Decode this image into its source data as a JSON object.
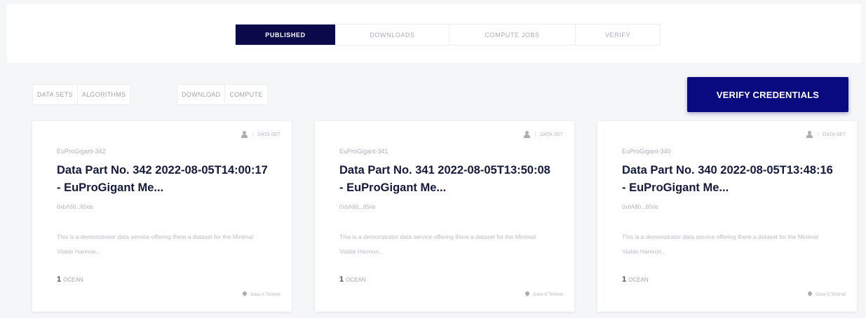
{
  "main_tabs": [
    {
      "label": "PUBLISHED",
      "active": true
    },
    {
      "label": "DOWNLOADS",
      "active": false
    },
    {
      "label": "COMPUTE JOBS",
      "active": false
    },
    {
      "label": "VERIFY",
      "active": false
    }
  ],
  "filters": {
    "asset_type": [
      "DATA SETS",
      "ALGORITHMS"
    ],
    "access_type": [
      "DOWNLOAD",
      "COMPUTE"
    ]
  },
  "verify_button": {
    "label": "VERIFY CREDENTIALS"
  },
  "cards": [
    {
      "type_label": "DATA SET",
      "symbol": "EuProGigant-342",
      "title": "Data Part No. 342 2022-08-05T14:00:17 - EuProGigant Me...",
      "author": "0xbA80...85eb",
      "description": "This is a demonstrator data service offering there a dataset for the Minimal Viable Harmon...",
      "price_value": "1",
      "price_currency": "OCEAN",
      "footer": "Gaia-X Testnet"
    },
    {
      "type_label": "DATA SET",
      "symbol": "EuProGigant-341",
      "title": "Data Part No. 341 2022-08-05T13:50:08 - EuProGigant Me...",
      "author": "0xbA80...85eb",
      "description": "This is a demonstrator data service offering there a dataset for the Minimal Viable Harmon...",
      "price_value": "1",
      "price_currency": "OCEAN",
      "footer": "Gaia-X Testnet"
    },
    {
      "type_label": "DATA SET",
      "symbol": "EuProGigant-340",
      "title": "Data Part No. 340 2022-08-05T13:48:16 - EuProGigant Me...",
      "author": "0xbA80...85eb",
      "description": "This is a demonstrator data service offering there a dataset for the Minimal Viable Harmon...",
      "price_value": "1",
      "price_currency": "OCEAN",
      "footer": "Gaia-X Testnet"
    }
  ],
  "colors": {
    "active_tab": "#0a0a4a",
    "verify_button": "#0a0a80",
    "title_text": "#141a3a"
  }
}
